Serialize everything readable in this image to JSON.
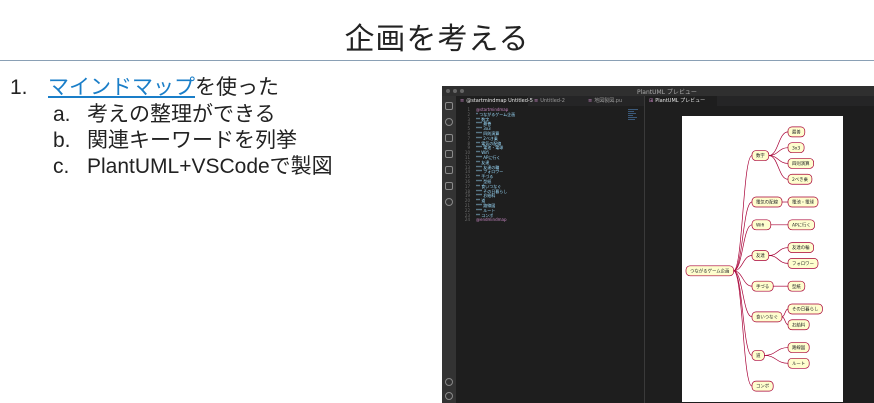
{
  "slide": {
    "title": "企画を考える"
  },
  "bullets": {
    "number": "1.",
    "link_text": "マインドマップ",
    "rest_text": "を使った",
    "subs": [
      {
        "letter": "a.",
        "text": "考えの整理ができる"
      },
      {
        "letter": "b.",
        "text": "関連キーワードを列挙"
      },
      {
        "letter": "c.",
        "text": "PlantUML+VSCodeで製図"
      }
    ]
  },
  "editor": {
    "window_title": "PlantUML プレビュー",
    "left_tabs": [
      {
        "label": "@startmindmap Untitled-5",
        "active": true
      },
      {
        "label": "Untitled-2",
        "active": false
      },
      {
        "label": "地図製図.pu",
        "active": false
      }
    ],
    "right_tab": {
      "label": "PlantUML プレビュー",
      "active": true
    },
    "code_lines": [
      {
        "no": "1",
        "text": "@startmindmap"
      },
      {
        "no": "2",
        "text": "* つながるゲーム企画"
      },
      {
        "no": "3",
        "text": "** 数字"
      },
      {
        "no": "4",
        "text": "*** 最善"
      },
      {
        "no": "5",
        "text": "*** 3x3"
      },
      {
        "no": "6",
        "text": "*** 四則演算"
      },
      {
        "no": "7",
        "text": "*** 2ベき乗"
      },
      {
        "no": "8",
        "text": "** 電気の配線"
      },
      {
        "no": "9",
        "text": "*** 電池・電球"
      },
      {
        "no": "10",
        "text": "** Wifi"
      },
      {
        "no": "11",
        "text": "*** APに行く"
      },
      {
        "no": "12",
        "text": "** 友達"
      },
      {
        "no": "13",
        "text": "*** 友達の輪"
      },
      {
        "no": "14",
        "text": "*** フォロワー"
      },
      {
        "no": "15",
        "text": "** 手づる"
      },
      {
        "no": "16",
        "text": "*** 型紙"
      },
      {
        "no": "17",
        "text": "** 食いつなぐ"
      },
      {
        "no": "18",
        "text": "*** その日暮らし"
      },
      {
        "no": "19",
        "text": "*** お給料"
      },
      {
        "no": "20",
        "text": "** 道"
      },
      {
        "no": "21",
        "text": "*** 路線図"
      },
      {
        "no": "22",
        "text": "*** ルート"
      },
      {
        "no": "23",
        "text": "** コンボ"
      },
      {
        "no": "24",
        "text": "@endmindmap"
      }
    ]
  },
  "mindmap": {
    "root": "つながるゲーム企画",
    "branches": [
      {
        "label": "数字",
        "children": [
          "最善",
          "3x3",
          "四則演算",
          "2ベき乗"
        ]
      },
      {
        "label": "電気の配線",
        "children": [
          "電池・電球"
        ]
      },
      {
        "label": "Wifi",
        "children": [
          "APに行く"
        ]
      },
      {
        "label": "友達",
        "children": [
          "友達の輪",
          "フォロワー"
        ]
      },
      {
        "label": "手づる",
        "children": [
          "型紙"
        ]
      },
      {
        "label": "食いつなぐ",
        "children": [
          "その日暮らし",
          "お給料"
        ]
      },
      {
        "label": "道",
        "children": [
          "路線図",
          "ルート"
        ]
      },
      {
        "label": "コンボ",
        "children": []
      }
    ],
    "colors": {
      "node_fill": "#fefece",
      "node_border": "#a80036",
      "line": "#a80036"
    }
  }
}
